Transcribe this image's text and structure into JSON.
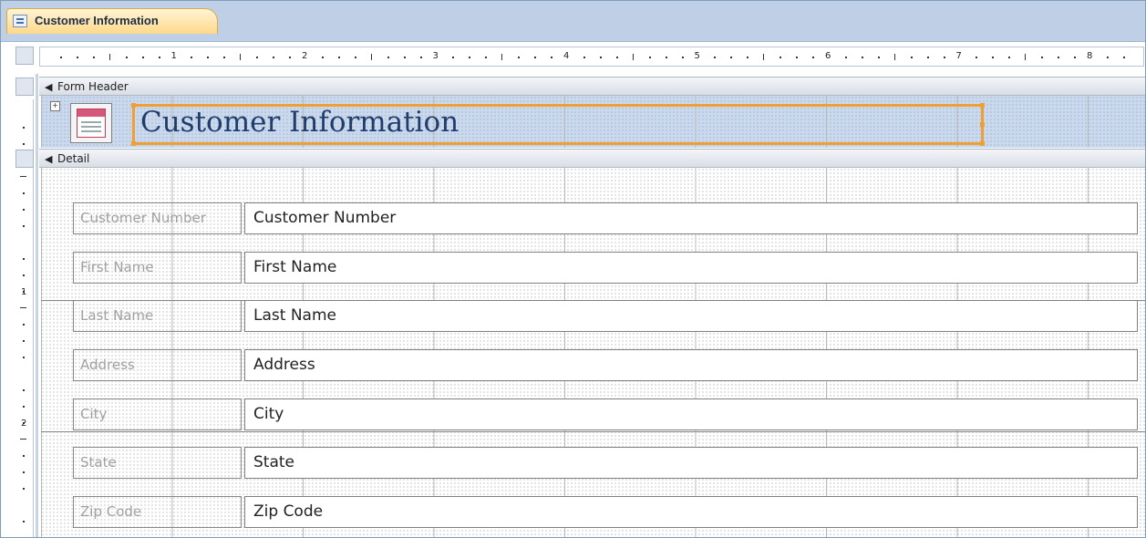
{
  "document_tab": {
    "title": "Customer Information",
    "icon": "form-icon"
  },
  "ruler": {
    "horizontal_numbers": [
      "1",
      "2",
      "3",
      "4",
      "5",
      "6",
      "7",
      "8"
    ],
    "vertical_numbers": [
      "1",
      "2"
    ]
  },
  "sections": {
    "form_header": "Form Header",
    "detail": "Detail"
  },
  "header": {
    "title": "Customer Information",
    "selection_color": "#f0a033"
  },
  "fields": [
    {
      "label": "Customer Number",
      "control": "Customer Number"
    },
    {
      "label": "First Name",
      "control": "First Name"
    },
    {
      "label": "Last Name",
      "control": "Last Name"
    },
    {
      "label": "Address",
      "control": "Address"
    },
    {
      "label": "City",
      "control": "City"
    },
    {
      "label": "State",
      "control": "State"
    },
    {
      "label": "Zip Code",
      "control": "Zip Code"
    }
  ]
}
